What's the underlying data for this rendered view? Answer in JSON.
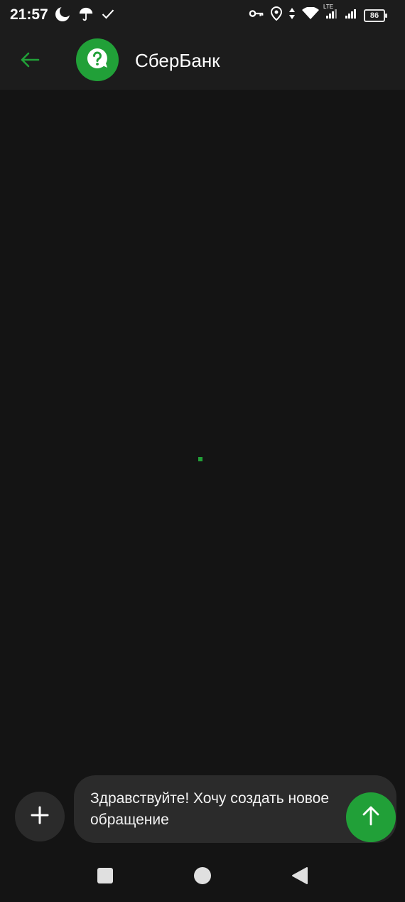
{
  "status_bar": {
    "time": "21:57",
    "network_label": "LTE",
    "battery": "86",
    "left_icons": [
      "moon-icon",
      "umbrella-icon",
      "check-icon"
    ],
    "right_icons": [
      "key-icon",
      "location-icon",
      "data-arrows-icon",
      "wifi-icon",
      "signal-icon",
      "signal-icon",
      "battery-icon"
    ]
  },
  "app_bar": {
    "title": "СберБанк",
    "avatar_icon": "question-bubble-icon",
    "back_icon": "arrow-left-icon"
  },
  "composer": {
    "message": "Здравствуйте! Хочу создать новое обращение",
    "attach_icon": "plus-icon",
    "send_icon": "arrow-up-icon"
  },
  "colors": {
    "accent": "#21a038",
    "background": "#141414",
    "bar": "#1c1c1c",
    "field": "#2b2b2b"
  },
  "nav": [
    "square-icon",
    "circle-icon",
    "triangle-back-icon"
  ]
}
